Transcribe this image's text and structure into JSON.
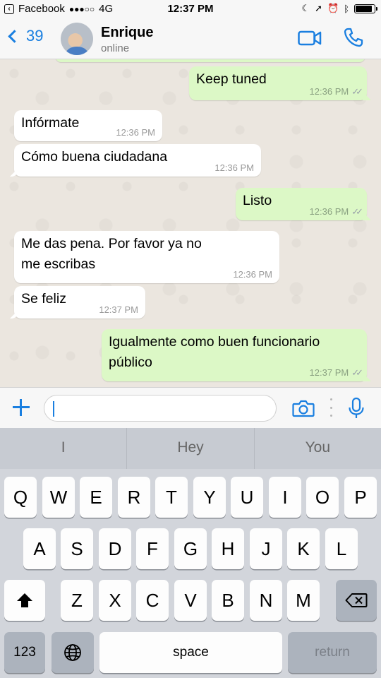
{
  "status_bar": {
    "carrier": "Facebook",
    "signal": "●●●○○",
    "network": "4G",
    "time": "12:37 PM"
  },
  "header": {
    "back_count": "39",
    "contact_name": "Enrique",
    "contact_status": "online"
  },
  "messages": [
    {
      "dir": "out",
      "text": "Keep tuned",
      "time": "12:36 PM",
      "ticks": "✓✓"
    },
    {
      "dir": "in",
      "text": "Infórmate",
      "time": "12:36 PM"
    },
    {
      "dir": "in",
      "text": "Cómo buena ciudadana",
      "time": "12:36 PM"
    },
    {
      "dir": "out",
      "text": "Listo",
      "time": "12:36 PM",
      "ticks": "✓✓"
    },
    {
      "dir": "in",
      "text": "Me das pena. Por favor ya no me escribas",
      "time": "12:36 PM"
    },
    {
      "dir": "in",
      "text": "Se feliz",
      "time": "12:37 PM"
    },
    {
      "dir": "out",
      "text": "Igualmente como buen funcionario público",
      "time": "12:37 PM",
      "ticks": "✓✓"
    }
  ],
  "input": {
    "value": "",
    "placeholder": ""
  },
  "keyboard": {
    "predictions": [
      "I",
      "Hey",
      "You"
    ],
    "row1": [
      "Q",
      "W",
      "E",
      "R",
      "T",
      "Y",
      "U",
      "I",
      "O",
      "P"
    ],
    "row2": [
      "A",
      "S",
      "D",
      "F",
      "G",
      "H",
      "J",
      "K",
      "L"
    ],
    "row3": [
      "Z",
      "X",
      "C",
      "V",
      "B",
      "N",
      "M"
    ],
    "numbers_label": "123",
    "space_label": "space",
    "return_label": "return"
  },
  "colors": {
    "accent": "#1a7fe0",
    "outgoing_bubble": "#dcf8c6",
    "incoming_bubble": "#ffffff",
    "chat_bg": "#ebe6df"
  }
}
